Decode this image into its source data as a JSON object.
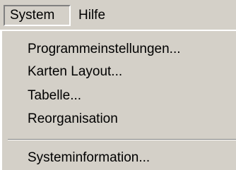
{
  "menubar": {
    "items": [
      {
        "label": "System"
      },
      {
        "label": "Hilfe"
      }
    ]
  },
  "dropdown": {
    "items": [
      {
        "label": "Programmeinstellungen..."
      },
      {
        "label": "Karten Layout..."
      },
      {
        "label": "Tabelle..."
      },
      {
        "label": "Reorganisation"
      },
      {
        "label": "Systeminformation..."
      }
    ]
  },
  "colors": {
    "menu_background": "#d4d0c8",
    "shadow": "#808080",
    "highlight": "#ffffff",
    "text": "#000000"
  }
}
